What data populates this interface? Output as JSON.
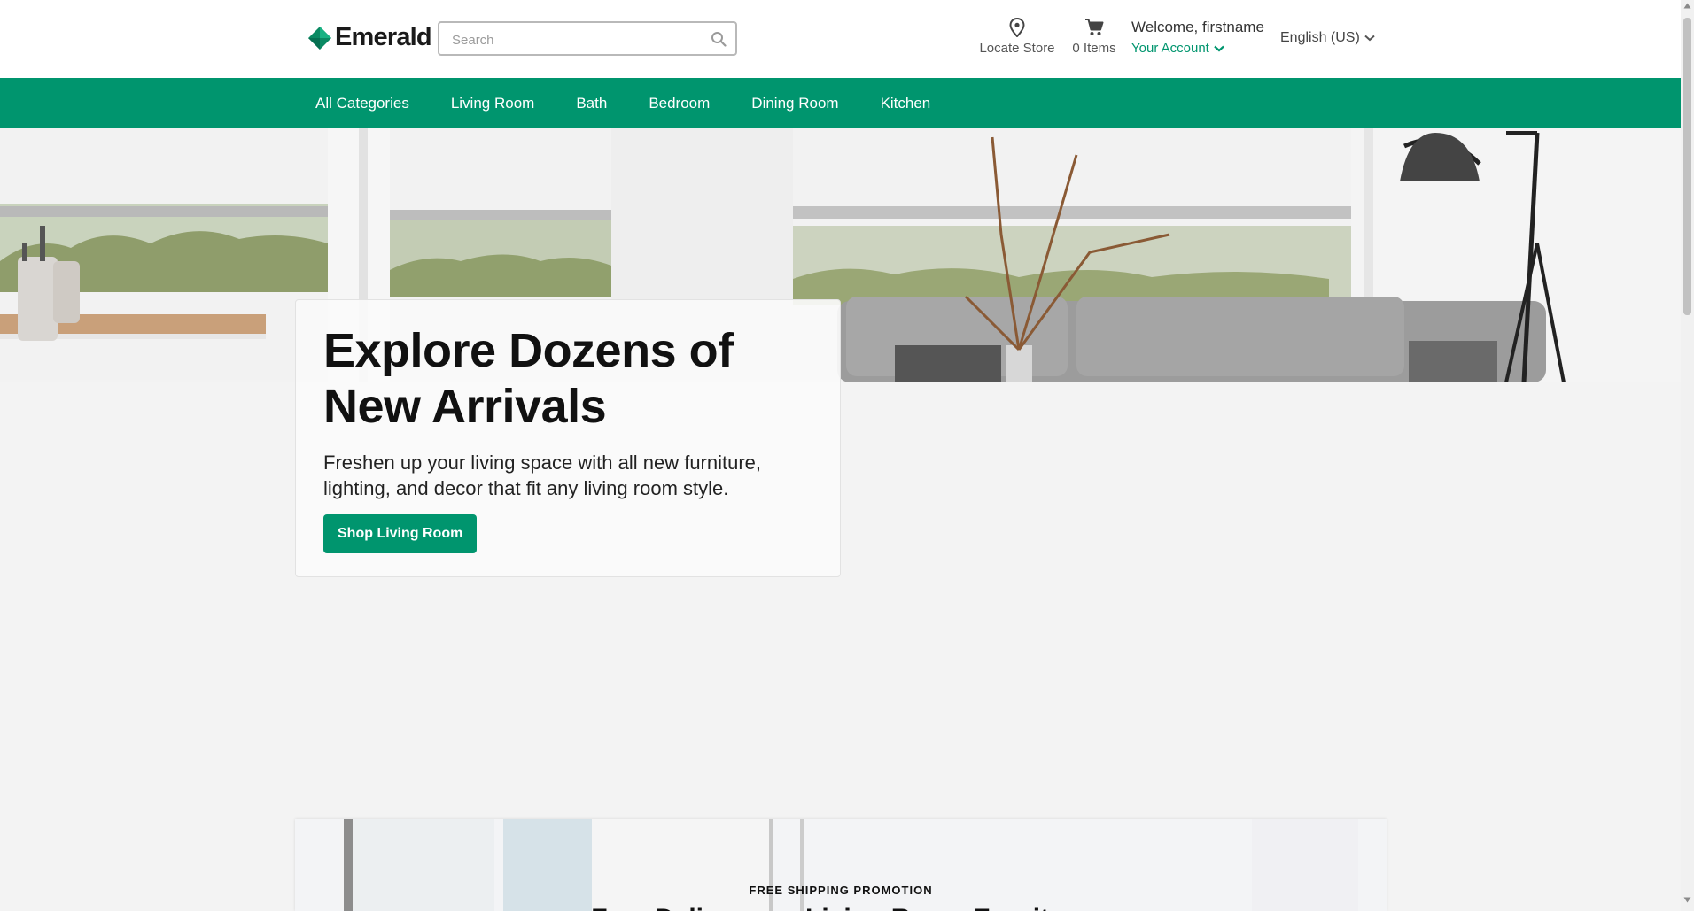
{
  "brand": {
    "name": "Emerald",
    "accent": "#00956e"
  },
  "search": {
    "placeholder": "Search",
    "value": ""
  },
  "header": {
    "locate_store": {
      "label": "Locate Store",
      "icon": "map-pin-icon"
    },
    "cart": {
      "label": "0 Items",
      "icon": "cart-icon"
    },
    "account": {
      "welcome": "Welcome, firstname",
      "link": "Your Account"
    },
    "language": "English (US)"
  },
  "nav": {
    "items": [
      {
        "label": "All Categories"
      },
      {
        "label": "Living Room"
      },
      {
        "label": "Bath"
      },
      {
        "label": "Bedroom"
      },
      {
        "label": "Dining Room"
      },
      {
        "label": "Kitchen"
      }
    ]
  },
  "hero": {
    "title": "Explore Dozens of New Arrivals",
    "subtitle": "Freshen up your living space with all new furniture, lighting, and decor that fit any living room style.",
    "button": "Shop Living Room"
  },
  "promo": {
    "label": "FREE SHIPPING PROMOTION",
    "heading": "Free Delivery on Living Room Furniture"
  }
}
